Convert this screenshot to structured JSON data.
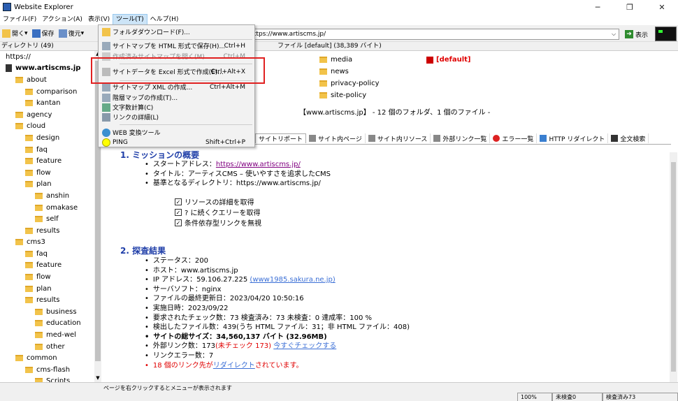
{
  "window": {
    "title": "Website Explorer"
  },
  "menubar": [
    "ファイル(F)",
    "アクション(A)",
    "表示(V)",
    "ツール(T)",
    "ヘルプ(H)"
  ],
  "toolbar": {
    "open": "開く",
    "save": "保存",
    "restore": "復元",
    "address": "ttps://www.artiscms.jp/",
    "go": "表示"
  },
  "tree_header": "ディレクトリ (49)",
  "tree": [
    {
      "label": "https://",
      "level": 0,
      "kind": "root"
    },
    {
      "label": "www.artiscms.jp",
      "level": 0,
      "kind": "site"
    },
    {
      "label": "about",
      "level": 1
    },
    {
      "label": "comparison",
      "level": 2
    },
    {
      "label": "kantan",
      "level": 2
    },
    {
      "label": "agency",
      "level": 1
    },
    {
      "label": "cloud",
      "level": 1
    },
    {
      "label": "design",
      "level": 2
    },
    {
      "label": "faq",
      "level": 2
    },
    {
      "label": "feature",
      "level": 2
    },
    {
      "label": "flow",
      "level": 2
    },
    {
      "label": "plan",
      "level": 2
    },
    {
      "label": "anshin",
      "level": 3
    },
    {
      "label": "omakase",
      "level": 3
    },
    {
      "label": "self",
      "level": 3
    },
    {
      "label": "results",
      "level": 2
    },
    {
      "label": "cms3",
      "level": 1
    },
    {
      "label": "faq",
      "level": 2
    },
    {
      "label": "feature",
      "level": 2
    },
    {
      "label": "flow",
      "level": 2
    },
    {
      "label": "plan",
      "level": 2
    },
    {
      "label": "results",
      "level": 2
    },
    {
      "label": "business",
      "level": 3
    },
    {
      "label": "education",
      "level": 3
    },
    {
      "label": "med-wel",
      "level": 3
    },
    {
      "label": "other",
      "level": 3
    },
    {
      "label": "common",
      "level": 1
    },
    {
      "label": "cms-flash",
      "level": 2
    },
    {
      "label": "Scripts",
      "level": 3
    }
  ],
  "file_header": "ファイル [default] (38,389 バイト)",
  "files": {
    "media": "media",
    "news": "news",
    "privacy": "privacy-policy",
    "site": "site-policy",
    "default": "[default]"
  },
  "summary": "【www.artiscms.jp】 - 12 個のフォルダ、1 個のファイル -",
  "tabs": [
    "サイトリポート",
    "サイト内ページ",
    "サイト内リソース",
    "外部リンク一覧",
    "エラー一覧",
    "HTTP リダイレクト",
    "全文検索"
  ],
  "report": {
    "sec1": "1. ミッションの概要",
    "start_label": "スタートアドレス：",
    "start_url": "https://www.artiscms.jp/",
    "title_line": "タイトル：アーティスCMS – 使いやすさを追求したCMS",
    "base_line": "基準となるディレクトリ：https://www.artiscms.jp/",
    "opt1": "リソースの詳細を取得",
    "opt2": "? に続くクエリーを取得",
    "opt3": "条件依存型リンクを無視",
    "sec2": "2. 探査結果",
    "status": "ステータス：200",
    "host": "ホスト：www.artiscms.jp",
    "ip_label": "IP アドレス：59.106.27.225",
    "ip_host": "(www1985.sakura.ne.jp)",
    "server": "サーバソフト：nginx",
    "modified": "ファイルの最終更新日：2023/04/20 10:50:16",
    "date": "実施日時：2023/09/22",
    "checks": "要求されたチェック数：73 検査済み：73 未検査：0 達成率：100 %",
    "files_detected": "検出したファイル数：439(うち HTML ファイル：31；非 HTML ファイル：408)",
    "total_size": "サイトの総サイズ：34,560,137 バイト (32.96MB)",
    "ext_label": "外部リンク数：173",
    "ext_unchecked": "(未チェック 173)",
    "ext_check": "今すぐチェックする",
    "link_err": "リンクエラー数：7",
    "redirect_pre": "18 個のリンク先が",
    "redirect_link": "リダイレクト",
    "redirect_post": "されています。"
  },
  "status": {
    "msg": "ページを右クリックするとメニューが表示されます",
    "zoom": "100%",
    "unchecked": "未検査0",
    "checked": "検査済み73"
  },
  "menu": [
    {
      "label": "フォルダダウンロード(F)...",
      "shortcut": "",
      "disabled": false
    },
    {
      "label": "サイトマップを HTML 形式で保存(H)...",
      "shortcut": "Ctrl+H",
      "disabled": false
    },
    {
      "label": "作成済みサイトマップを開く(M)...",
      "shortcut": "Ctrl+M",
      "disabled": true
    },
    {
      "label": "サイトデータを Excel 形式で作成(E)...",
      "shortcut": "Ctrl+Alt+X",
      "disabled": false
    },
    {
      "label": "サイトマップ XML の作成...",
      "shortcut": "Ctrl+Alt+M",
      "disabled": false
    },
    {
      "label": "階層マップの作成(T)...",
      "shortcut": "",
      "disabled": false
    },
    {
      "label": "文字数計算(C)",
      "shortcut": "",
      "disabled": false
    },
    {
      "label": "リンクの詳細(L)",
      "shortcut": "",
      "disabled": false
    },
    {
      "label": "WEB 変換ツール",
      "shortcut": "",
      "disabled": false
    },
    {
      "label": "PING",
      "shortcut": "Shift+Ctrl+P",
      "disabled": false
    }
  ]
}
